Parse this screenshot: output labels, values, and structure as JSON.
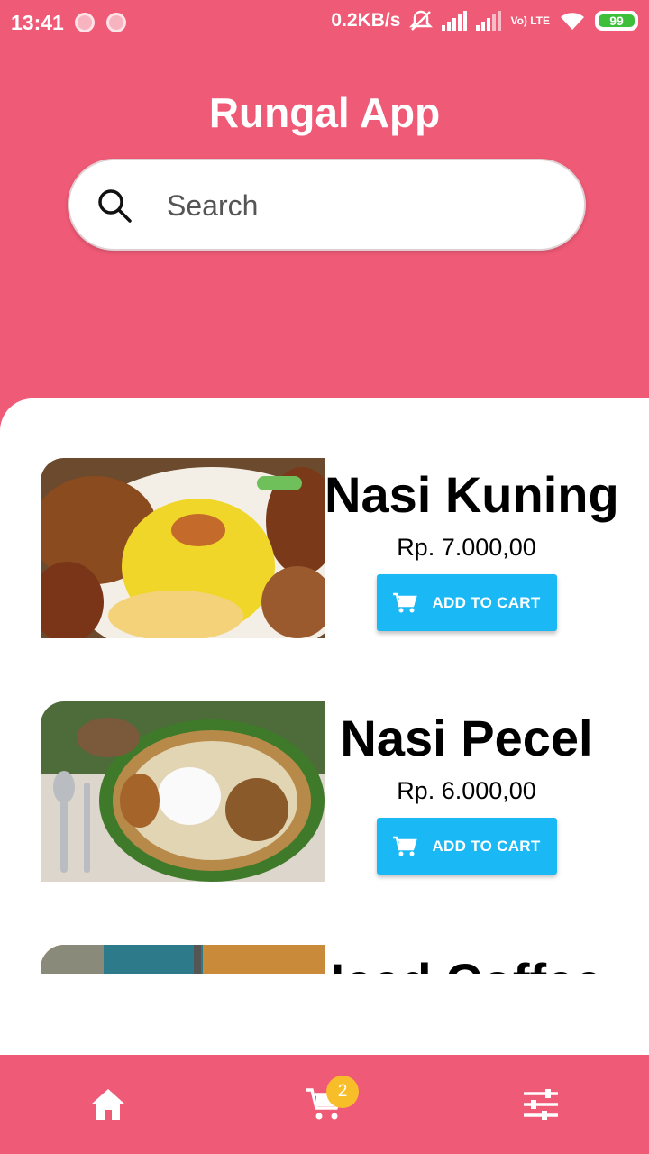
{
  "status_bar": {
    "time": "13:41",
    "speed": "0.2KB/s",
    "network": "Vo) LTE",
    "battery": "99"
  },
  "app": {
    "title": "Rungal App"
  },
  "search": {
    "placeholder": "Search"
  },
  "products": [
    {
      "name": "Nasi Kuning",
      "price": "Rp. 7.000,00",
      "button": "ADD TO CART"
    },
    {
      "name": "Nasi Pecel",
      "price": "Rp. 6.000,00",
      "button": "ADD TO CART"
    },
    {
      "name": "Iced Coffee"
    }
  ],
  "nav": {
    "cart_count": "2",
    "active": "home"
  },
  "colors": {
    "primary": "#ef5a76",
    "button": "#1ab9f5",
    "badge": "#f7be2a"
  },
  "icons": [
    "search-icon",
    "cart-icon",
    "home-icon",
    "settings-icon"
  ]
}
